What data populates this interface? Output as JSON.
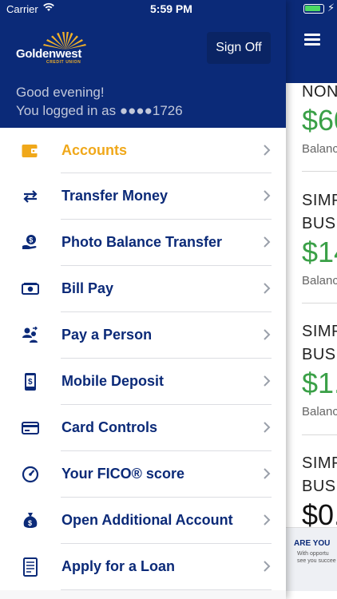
{
  "status_bar": {
    "carrier": "Carrier",
    "time": "5:59 PM"
  },
  "header": {
    "logo_text": "Goldenwest",
    "logo_subtext": "CREDIT UNION",
    "sign_off_label": "Sign Off",
    "greeting": "Good evening!",
    "logged_in_text": "You logged in as ●●●●1726"
  },
  "menu": {
    "items": [
      {
        "label": "Accounts",
        "icon": "wallet-icon",
        "active": true
      },
      {
        "label": "Transfer Money",
        "icon": "transfer-arrows-icon"
      },
      {
        "label": "Photo Balance Transfer",
        "icon": "hand-money-icon"
      },
      {
        "label": "Bill Pay",
        "icon": "bill-cash-icon"
      },
      {
        "label": "Pay a Person",
        "icon": "people-transfer-icon"
      },
      {
        "label": "Mobile Deposit",
        "icon": "mobile-check-icon"
      },
      {
        "label": "Card Controls",
        "icon": "credit-card-icon"
      },
      {
        "label": "Your FICO® score",
        "icon": "gauge-icon"
      },
      {
        "label": "Open Additional Account",
        "icon": "money-bag-icon"
      },
      {
        "label": "Apply for a Loan",
        "icon": "document-icon"
      }
    ]
  },
  "background_panel": {
    "accounts": [
      {
        "name_line1": "NON",
        "amount": "$60",
        "balance_label": "Balanc"
      },
      {
        "name_line1": "SIMP",
        "name_line2": "BUSI",
        "amount": "$14",
        "balance_label": "Balanc"
      },
      {
        "name_line1": "SIMP",
        "name_line2": "BUSI",
        "amount": "$1.",
        "balance_label": "Balanc"
      },
      {
        "name_line1": "SIMP",
        "name_line2": "BUSI",
        "amount": "$0."
      }
    ],
    "ad_title": "ARE YOU",
    "ad_sub_line1": "With opportu",
    "ad_sub_line2": "see you succee"
  },
  "colors": {
    "brand_navy": "#0b2a78",
    "accent_gold": "#f0a81a",
    "positive_green": "#3aa047"
  }
}
